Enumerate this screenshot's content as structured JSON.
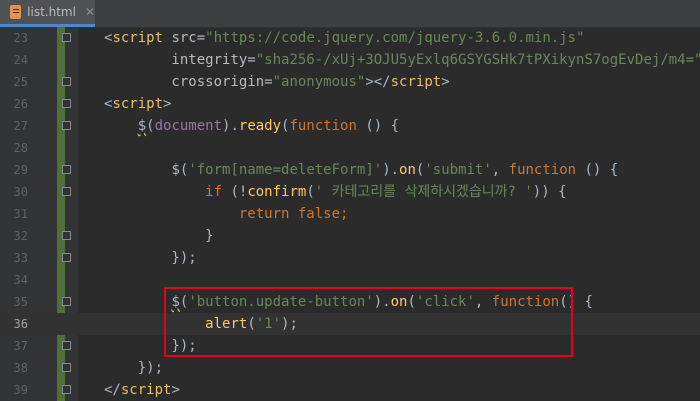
{
  "tab": {
    "icon": "html-file-icon",
    "label": "list.html",
    "close": "✕"
  },
  "editor": {
    "current_line": 36,
    "lines": [
      {
        "n": "23",
        "tokens": [
          {
            "t": "<",
            "c": "t-punc"
          },
          {
            "t": "script",
            "c": "t-tag"
          },
          {
            "t": " src",
            "c": "t-attr"
          },
          {
            "t": "=",
            "c": "t-punc"
          },
          {
            "t": "\"https://code.jquery.com/jquery-3.6.0.min.js\"",
            "c": "t-str"
          }
        ]
      },
      {
        "n": "24",
        "tokens": [
          {
            "t": "        integrity",
            "c": "t-attr"
          },
          {
            "t": "=",
            "c": "t-punc"
          },
          {
            "t": "\"sha256-/xUj+3OJU5yExlq6GSYGSHk7tPXikynS7ogEvDej/m4=\"",
            "c": "t-str"
          }
        ]
      },
      {
        "n": "25",
        "tokens": [
          {
            "t": "        crossorigin",
            "c": "t-attr"
          },
          {
            "t": "=",
            "c": "t-punc"
          },
          {
            "t": "\"anonymous\"",
            "c": "t-str"
          },
          {
            "t": "></",
            "c": "t-punc"
          },
          {
            "t": "script",
            "c": "t-tag"
          },
          {
            "t": ">",
            "c": "t-punc"
          }
        ]
      },
      {
        "n": "26",
        "tokens": [
          {
            "t": "<",
            "c": "t-punc"
          },
          {
            "t": "script",
            "c": "t-tag"
          },
          {
            "t": ">",
            "c": "t-punc"
          }
        ]
      },
      {
        "n": "27",
        "tokens": [
          {
            "t": "    ",
            "c": "t-plain"
          },
          {
            "t": "$",
            "c": "t-dollar"
          },
          {
            "t": "(",
            "c": "t-punc"
          },
          {
            "t": "document",
            "c": "t-var"
          },
          {
            "t": ").",
            "c": "t-punc"
          },
          {
            "t": "ready",
            "c": "t-fn"
          },
          {
            "t": "(",
            "c": "t-punc"
          },
          {
            "t": "function",
            "c": "t-kw"
          },
          {
            "t": " () {",
            "c": "t-punc"
          }
        ]
      },
      {
        "n": "28",
        "tokens": []
      },
      {
        "n": "29",
        "tokens": [
          {
            "t": "        ",
            "c": "t-plain"
          },
          {
            "t": "$",
            "c": "t-punc"
          },
          {
            "t": "(",
            "c": "t-punc"
          },
          {
            "t": "'form[name=deleteForm]'",
            "c": "t-sel"
          },
          {
            "t": ").",
            "c": "t-punc"
          },
          {
            "t": "on",
            "c": "t-fn"
          },
          {
            "t": "(",
            "c": "t-punc"
          },
          {
            "t": "'submit'",
            "c": "t-str"
          },
          {
            "t": ", ",
            "c": "t-punc"
          },
          {
            "t": "function",
            "c": "t-kw"
          },
          {
            "t": " () {",
            "c": "t-punc"
          }
        ]
      },
      {
        "n": "30",
        "tokens": [
          {
            "t": "            ",
            "c": "t-plain"
          },
          {
            "t": "if",
            "c": "t-kw"
          },
          {
            "t": " (!",
            "c": "t-punc"
          },
          {
            "t": "confirm",
            "c": "t-fn"
          },
          {
            "t": "(",
            "c": "t-punc"
          },
          {
            "t": "' 카테고리를 삭제하시겠습니까? '",
            "c": "t-str"
          },
          {
            "t": ")) {",
            "c": "t-punc"
          }
        ]
      },
      {
        "n": "31",
        "tokens": [
          {
            "t": "                ",
            "c": "t-plain"
          },
          {
            "t": "return false",
            "c": "t-kw"
          },
          {
            "t": ";",
            "c": "t-kw"
          }
        ]
      },
      {
        "n": "32",
        "tokens": [
          {
            "t": "            }",
            "c": "t-punc"
          }
        ]
      },
      {
        "n": "33",
        "tokens": [
          {
            "t": "        });",
            "c": "t-punc"
          }
        ]
      },
      {
        "n": "34",
        "tokens": []
      },
      {
        "n": "35",
        "tokens": [
          {
            "t": "        ",
            "c": "t-plain"
          },
          {
            "t": "$",
            "c": "t-dollar"
          },
          {
            "t": "(",
            "c": "t-punc"
          },
          {
            "t": "'button.update-button'",
            "c": "t-sel"
          },
          {
            "t": ").",
            "c": "t-punc"
          },
          {
            "t": "on",
            "c": "t-fn"
          },
          {
            "t": "(",
            "c": "t-punc"
          },
          {
            "t": "'click'",
            "c": "t-str"
          },
          {
            "t": ", ",
            "c": "t-punc"
          },
          {
            "t": "function",
            "c": "t-kw"
          },
          {
            "t": "() {",
            "c": "t-punc"
          }
        ]
      },
      {
        "n": "36",
        "tokens": [
          {
            "t": "            ",
            "c": "t-plain"
          },
          {
            "t": "alert",
            "c": "t-fn"
          },
          {
            "t": "(",
            "c": "t-punc"
          },
          {
            "t": "'1'",
            "c": "t-str"
          },
          {
            "t": ");",
            "c": "t-punc"
          }
        ]
      },
      {
        "n": "37",
        "tokens": [
          {
            "t": "        });",
            "c": "t-punc"
          }
        ]
      },
      {
        "n": "38",
        "tokens": [
          {
            "t": "    });",
            "c": "t-punc"
          }
        ]
      },
      {
        "n": "39",
        "tokens": [
          {
            "t": "</",
            "c": "t-punc"
          },
          {
            "t": "script",
            "c": "t-tag"
          },
          {
            "t": ">",
            "c": "t-punc"
          }
        ]
      }
    ]
  },
  "colors": {
    "background": "#2b2b2b",
    "gutter": "#313335",
    "keyword": "#cc7832",
    "string": "#6a8759",
    "function": "#ffc66d",
    "tag": "#e8bf6a",
    "highlight_box": "#e8001c"
  }
}
